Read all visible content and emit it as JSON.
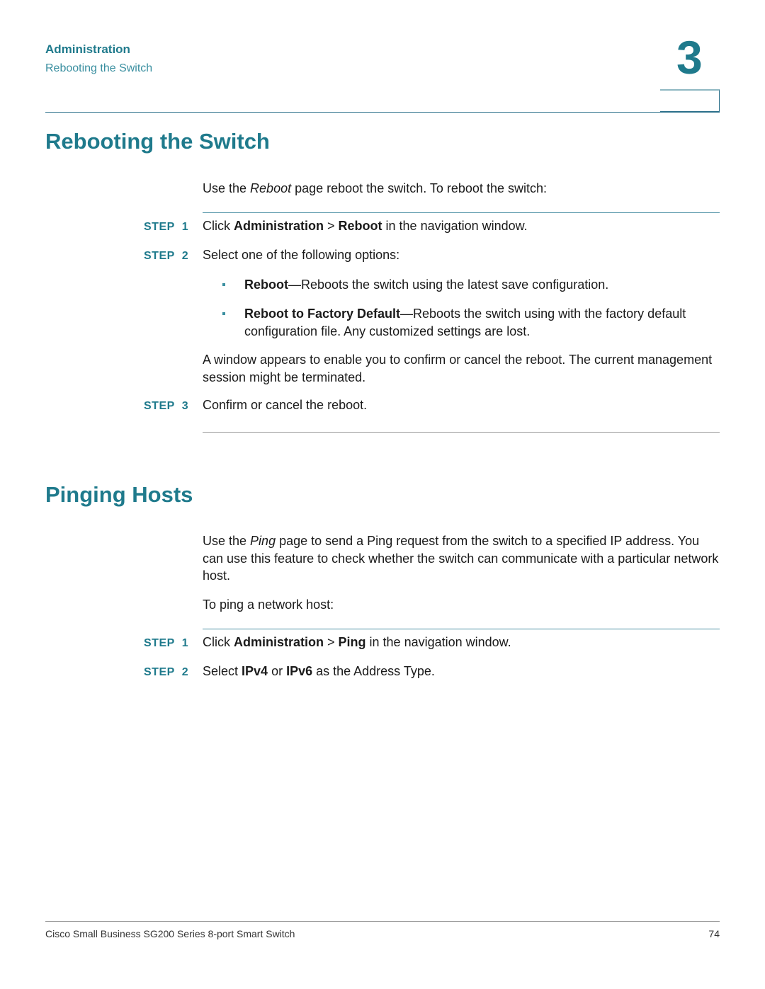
{
  "header": {
    "section": "Administration",
    "subsection": "Rebooting the Switch",
    "chapter_number": "3"
  },
  "reboot": {
    "title": "Rebooting the Switch",
    "intro": {
      "pre": "Use the ",
      "em": "Reboot",
      "post": " page reboot the switch. To reboot the switch:"
    },
    "steps": [
      {
        "label": "STEP",
        "num": "1",
        "parts": [
          "Click ",
          "Administration",
          " > ",
          "Reboot",
          " in the navigation window."
        ]
      },
      {
        "label": "STEP",
        "num": "2",
        "text": "Select one of the following options:"
      },
      {
        "label": "STEP",
        "num": "3",
        "text": "Confirm or cancel the reboot."
      }
    ],
    "options": [
      {
        "term": "Reboot",
        "desc": "—Reboots the switch using the latest save configuration."
      },
      {
        "term": "Reboot to Factory Default",
        "desc": "—Reboots the switch using with the factory default configuration file. Any customized settings are lost."
      }
    ],
    "note": "A window appears to enable you to confirm or cancel the reboot. The current management session might be terminated."
  },
  "ping": {
    "title": "Pinging Hosts",
    "intro": {
      "pre": "Use the ",
      "em": "Ping",
      "post": " page to send a Ping request from the switch to a specified IP address. You can use this feature to check whether the switch can communicate with a particular network host."
    },
    "lead": "To ping a network host:",
    "steps": [
      {
        "label": "STEP",
        "num": "1",
        "parts": [
          "Click ",
          "Administration",
          " > ",
          "Ping",
          " in the navigation window."
        ]
      },
      {
        "label": "STEP",
        "num": "2",
        "parts": [
          "Select ",
          "IPv4",
          " or ",
          "IPv6",
          " as the Address Type."
        ]
      }
    ]
  },
  "footer": {
    "title": "Cisco Small Business SG200 Series 8-port Smart Switch",
    "page": "74"
  }
}
